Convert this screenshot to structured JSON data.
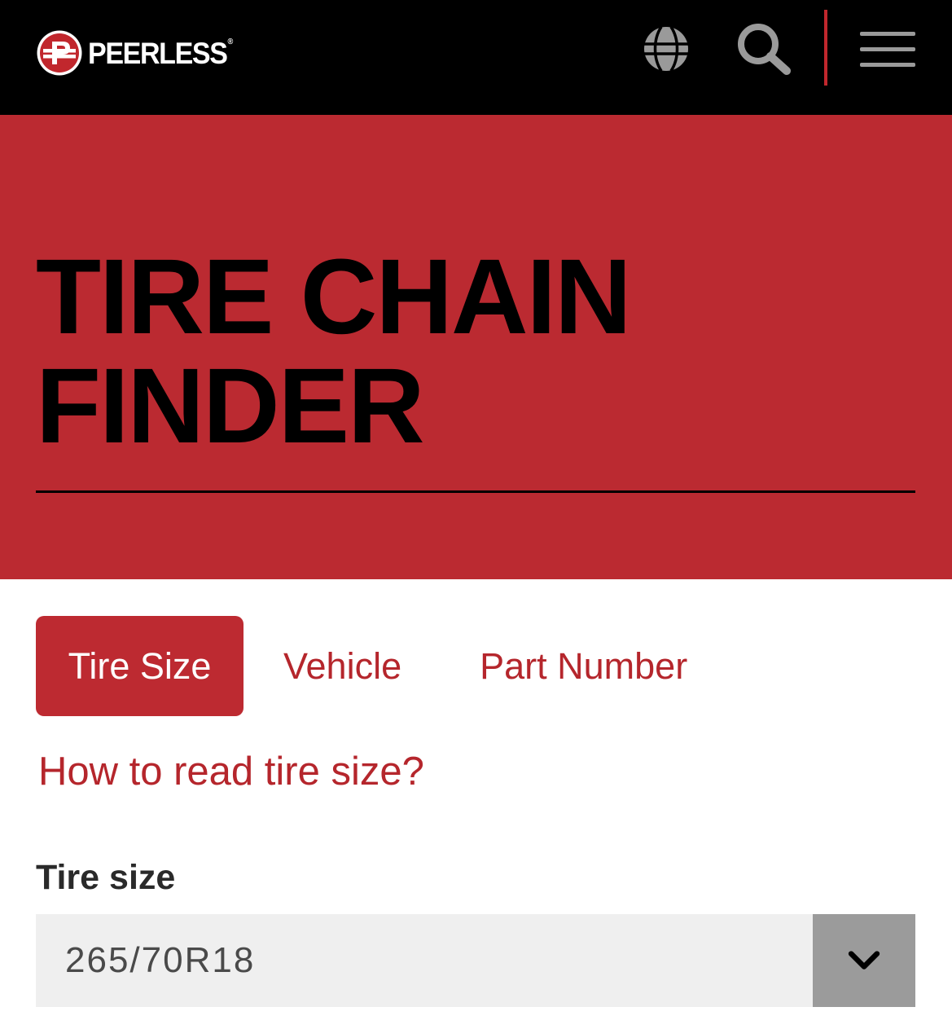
{
  "header": {
    "brand_name": "PEERLESS",
    "brand_mark": "®",
    "icons": {
      "globe": "globe-icon",
      "search": "search-icon",
      "menu": "hamburger-menu-icon"
    }
  },
  "hero": {
    "title_line1": "TIRE CHAIN",
    "title_line2": "FINDER"
  },
  "tabs": [
    {
      "label": "Tire Size",
      "active": true
    },
    {
      "label": "Vehicle",
      "active": false
    },
    {
      "label": "Part Number",
      "active": false
    }
  ],
  "help_link": "How to read tire size?",
  "tire_size": {
    "label": "Tire size",
    "selected_value": "265/70R18"
  },
  "colors": {
    "header_bg": "#000000",
    "hero_bg": "#bb2a31",
    "accent": "#bd2a31",
    "select_bg": "#efefef",
    "select_button": "#9b9b9b"
  }
}
